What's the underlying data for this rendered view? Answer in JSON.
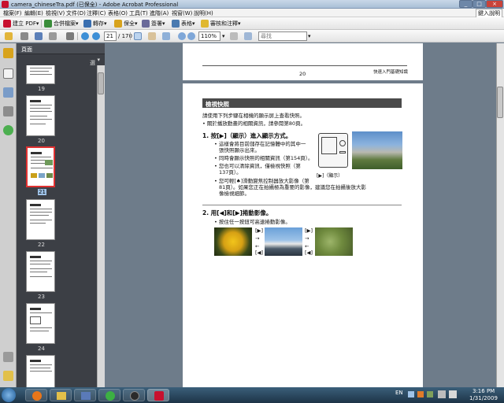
{
  "window": {
    "title": "camera_chineseTra.pdf (已保全) - Adobe Acrobat Professional",
    "minimize": "_",
    "maximize": "□",
    "close": "×"
  },
  "menu": {
    "items": [
      "檔案(F)",
      "編輯(E)",
      "檢視(V)",
      "文件(D)",
      "注釋(C)",
      "表格(O)",
      "工具(T)",
      "進階(A)",
      "視窗(W)",
      "說明(H)"
    ],
    "help_box": "鍵入說明"
  },
  "toolbar1": {
    "create_pdf": "建立 PDF",
    "combine": "合併檔案",
    "export": "轉存",
    "secure": "保全",
    "sign": "簽署",
    "forms": "表格",
    "review": "審核和注釋"
  },
  "toolbar2": {
    "page_current": "21",
    "page_total": "/ 170",
    "zoom": "110%",
    "search_placeholder": "尋找"
  },
  "panel": {
    "title": "頁面",
    "options": "選項"
  },
  "thumbnails": [
    {
      "label": "19"
    },
    {
      "label": "20"
    },
    {
      "label": "21"
    },
    {
      "label": "22"
    },
    {
      "label": "23"
    },
    {
      "label": "24"
    }
  ],
  "document": {
    "header_page_number": "20",
    "header_title": "快速入門基礎知識",
    "section_title": "檢視快照",
    "intro1": "請使用下列步驟在相機的顯示屏上查看快照。",
    "intro2": "• 關於播放動畫的相關資訊，請參閱第80頁。",
    "step1_title": "1.  按[▶]（顯示）進入顯示方式。",
    "step1_b1": "• 這樣會將目前儲存在記憶體中的其中一",
    "step1_b1b": "張快照顯示出來。",
    "step1_b2": "• 同時會顯示快照的相關資訊（第154頁）。",
    "step1_b3": "• 您也可以清除資訊，僅檢視快照（第",
    "step1_b3b": "137頁）。",
    "step1_b4": "• 您可輕[♠]滑動變焦控制器放大影像（第",
    "step1_b4b": "81頁）。如果您正在拍攝極為重要的影像，建議您在拍攝後放大影",
    "step1_b4c": "像檢視細節。",
    "camera_caption": "[▶]（顯示）",
    "step2_title": "2.  用[◀]和[▶]捲動影像。",
    "step2_b1": "• 按住任一按鈕可高速捲動影像。",
    "arrow_right": "[▶]",
    "arrow_left": "[◀]"
  },
  "taskbar": {
    "lang": "EN",
    "time": "3:16 PM",
    "date": "1/31/2009"
  }
}
